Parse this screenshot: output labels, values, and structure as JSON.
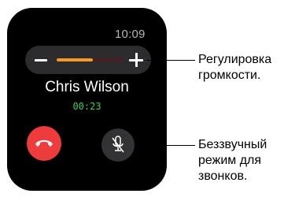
{
  "watch": {
    "time": "10:09",
    "volume": {
      "level": 0.55,
      "accent_color": "#f59a23",
      "track_color": "#4a1f1f",
      "minus_icon": "minus-icon",
      "plus_icon": "plus-icon"
    },
    "caller_name": "Chris Wilson",
    "call_duration": "00:23",
    "duration_color": "#31d158",
    "end_call": {
      "icon": "phone-hangup-icon",
      "color": "#ee3b3b"
    },
    "mute": {
      "icon": "microphone-slash-icon"
    }
  },
  "callouts": {
    "volume_line1": "Регулировка",
    "volume_line2": "громкости.",
    "mute_line1": "Беззвучный",
    "mute_line2": "режим для",
    "mute_line3": "звонков."
  }
}
